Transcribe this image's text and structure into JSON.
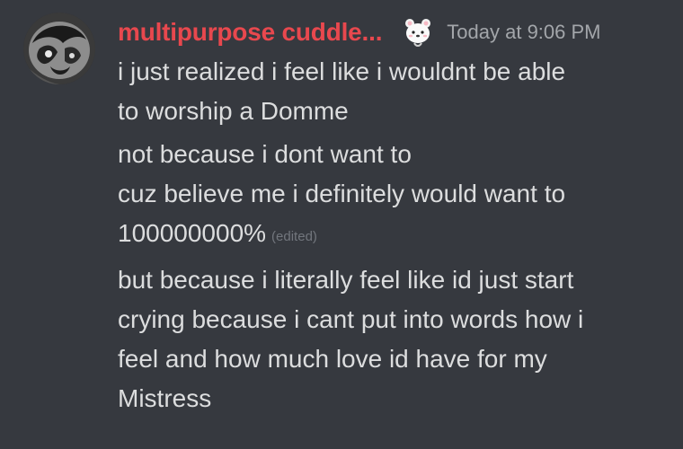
{
  "author": {
    "name": "multipurpose cuddle...",
    "name_color": "#e8484e",
    "avatar_icon": "avatar-image",
    "badge_icon": "bear-emoji-icon"
  },
  "timestamp": "Today at 9:06 PM",
  "messages": [
    {
      "lines": [
        "i just realized i feel like i wouldnt be able",
        "to worship a Domme"
      ]
    },
    {
      "lines": [
        "not because i dont want to",
        "cuz believe me i definitely would want to",
        "100000000%"
      ],
      "edited_label": "(edited)"
    },
    {
      "lines": [
        "but because i literally feel like id just start",
        "crying because i cant put into words how i",
        "feel and how much love id have for my",
        "Mistress"
      ]
    }
  ],
  "colors": {
    "background": "#36393f",
    "text": "#dcddde",
    "muted": "#a3a6aa"
  }
}
